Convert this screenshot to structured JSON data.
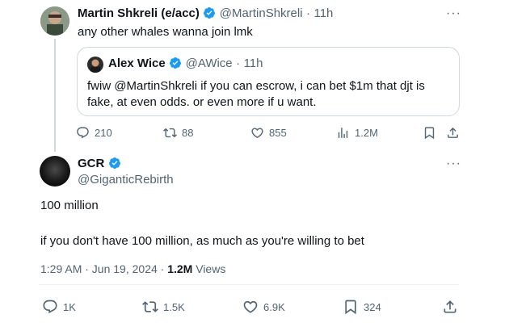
{
  "tweet1": {
    "author_name": "Martin Shkreli (e/acc)",
    "handle": "@MartinShkreli",
    "time": "11h",
    "text": "any other whales wanna join lmk",
    "quote": {
      "author_name": "Alex Wice",
      "handle": "@AWice",
      "time": "11h",
      "text": "fwiw @MartinShkreli  if you can escrow, i can bet $1m that djt is fake, at even odds.  or even more if u want."
    },
    "actions": {
      "replies": "210",
      "retweets": "88",
      "likes": "855",
      "views": "1.2M"
    }
  },
  "tweet2": {
    "author_name": "GCR",
    "handle": "@GiganticRebirth",
    "text_line1": "100 million",
    "text_line2": "if you don't have 100 million, as much as you're willing to bet",
    "meta_time": "1:29 AM · Jun 19, 2024 · ",
    "meta_views_count": "1.2M",
    "meta_views_label": " Views",
    "actions": {
      "replies": "1K",
      "retweets": "1.5K",
      "likes": "6.9K",
      "bookmarks": "324"
    }
  },
  "colors": {
    "verified": "#1d9bf0",
    "muted": "#536471",
    "border": "#cfd9de"
  },
  "icons": [
    "verified-badge-icon",
    "more-icon",
    "reply-icon",
    "retweet-icon",
    "like-icon",
    "views-icon",
    "bookmark-icon",
    "share-icon"
  ]
}
